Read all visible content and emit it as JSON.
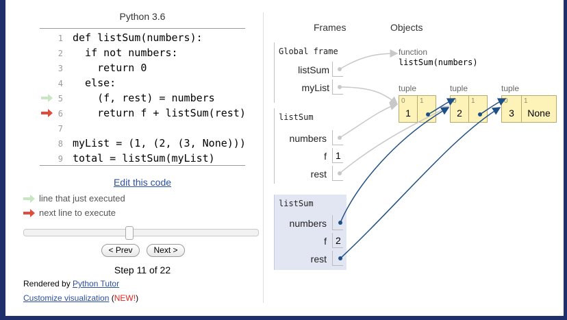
{
  "left_panel": {
    "language_title": "Python 3.6",
    "code_lines": [
      {
        "num": "1",
        "text": "def listSum(numbers):"
      },
      {
        "num": "2",
        "text": "  if not numbers:"
      },
      {
        "num": "3",
        "text": "    return 0"
      },
      {
        "num": "4",
        "text": "  else:"
      },
      {
        "num": "5",
        "text": "    (f, rest) = numbers"
      },
      {
        "num": "6",
        "text": "    return f + listSum(rest)"
      },
      {
        "num": "7",
        "text": ""
      },
      {
        "num": "8",
        "text": "myList = (1, (2, (3, None)))"
      },
      {
        "num": "9",
        "text": "total = listSum(myList)"
      }
    ],
    "prev_line_marker": "5",
    "next_line_marker": "6",
    "edit_link": "Edit this code",
    "legend": {
      "prev": "line that just executed",
      "next": "next line to execute"
    },
    "slider_progress": 0.476,
    "nav": {
      "prev": "< Prev",
      "next": "Next >"
    },
    "step": "Step 11 of 22",
    "rendered_by_prefix": "Rendered by ",
    "rendered_by_link": "Python Tutor",
    "customize_link": "Customize visualization",
    "customize_new": "NEW!",
    "colors": {
      "prev_arrow": "#c9e6c3",
      "next_arrow": "#e04c3c",
      "link": "#2a4fa0",
      "border": "#1f2f6b"
    }
  },
  "viz": {
    "frames_heading": "Frames",
    "objects_heading": "Objects",
    "global_frame": {
      "name": "Global frame",
      "vars": [
        {
          "name": "listSum"
        },
        {
          "name": "myList"
        }
      ]
    },
    "call_frame_1": {
      "name": "listSum",
      "vars": [
        {
          "name": "numbers",
          "value": ""
        },
        {
          "name": "f",
          "value": "1"
        },
        {
          "name": "rest",
          "value": ""
        }
      ]
    },
    "call_frame_2": {
      "name": "listSum",
      "vars": [
        {
          "name": "numbers",
          "value": ""
        },
        {
          "name": "f",
          "value": "2"
        },
        {
          "name": "rest",
          "value": ""
        }
      ]
    },
    "function_object": {
      "type": "function",
      "signature": "listSum(numbers)"
    },
    "tuples": [
      {
        "type": "tuple",
        "cells": [
          {
            "idx": "0",
            "value": "1"
          },
          {
            "idx": "1",
            "value": ""
          }
        ]
      },
      {
        "type": "tuple",
        "cells": [
          {
            "idx": "0",
            "value": "2"
          },
          {
            "idx": "1",
            "value": ""
          }
        ]
      },
      {
        "type": "tuple",
        "cells": [
          {
            "idx": "0",
            "value": "3"
          },
          {
            "idx": "1",
            "value": "None"
          }
        ]
      }
    ],
    "colors": {
      "pointer_light": "#c8c8c8",
      "pointer_active": "#1e4f86",
      "tuple_bg": "#fdf3b8",
      "active_frame_bg": "#e2e6f2"
    }
  }
}
